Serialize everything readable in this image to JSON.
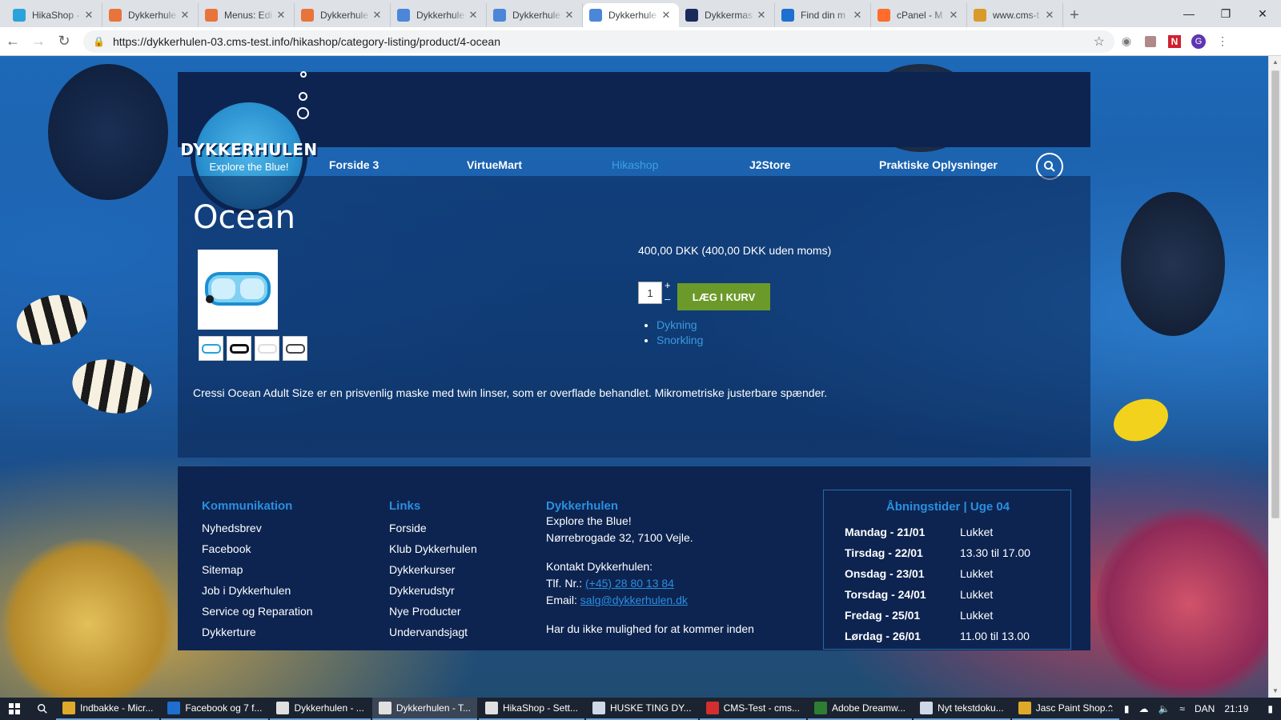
{
  "browser": {
    "tabs": [
      {
        "label": "HikaShop -",
        "color": "#29a3d9"
      },
      {
        "label": "Dykkerhule",
        "color": "#e8743b"
      },
      {
        "label": "Menus: Edi",
        "color": "#e8743b"
      },
      {
        "label": "Dykkerhule",
        "color": "#e8743b"
      },
      {
        "label": "Dykkerhule",
        "color": "#4b86d8"
      },
      {
        "label": "Dykkerhule",
        "color": "#4b86d8"
      },
      {
        "label": "Dykkerhule",
        "color": "#4b86d8"
      },
      {
        "label": "Dykkermas",
        "color": "#1a2a5a"
      },
      {
        "label": "Find din m",
        "color": "#1e6fcf"
      },
      {
        "label": "cPanel - M",
        "color": "#ff6c2c"
      },
      {
        "label": "www.cms-t",
        "color": "#d89b2a"
      }
    ],
    "active_tab_index": 6,
    "new_tab_symbol": "+",
    "url": "https://dykkerhulen-03.cms-test.info/hikashop/category-listing/product/4-ocean",
    "extension_letters": {
      "profile": "G",
      "n_ext": "N"
    }
  },
  "site": {
    "logo": {
      "brand": "DYKKERHULEN",
      "tagline": "Explore the Blue!"
    },
    "nav": [
      "Forside 3",
      "VirtueMart",
      "Hikashop",
      "J2Store",
      "Praktiske Oplysninger"
    ],
    "nav_active": "Hikashop"
  },
  "product": {
    "title": "Ocean",
    "price": "400,00 DKK (400,00 DKK uden moms)",
    "quantity": "1",
    "qty_plus": "+",
    "qty_minus": "–",
    "add_to_cart": "LÆG I KURV",
    "categories": [
      "Dykning",
      "Snorkling"
    ],
    "description": "Cressi Ocean Adult Size er en prisvenlig maske med twin linser, som er overflade behandlet. Mikrometriske justerbare spænder."
  },
  "footer": {
    "kommunikation": {
      "heading": "Kommunikation",
      "links": [
        "Nyhedsbrev",
        "Facebook",
        "Sitemap",
        "Job i Dykkerhulen",
        "Service og Reparation",
        "Dykkerture"
      ]
    },
    "links": {
      "heading": "Links",
      "links": [
        "Forside",
        "Klub Dykkerhulen",
        "Dykkerkurser",
        "Dykkerudstyr",
        "Nye Producter",
        "Undervandsjagt"
      ]
    },
    "contact": {
      "heading": "Dykkerhulen",
      "line1": "Explore the Blue!",
      "line2": "Nørrebrogade 32, 7100 Vejle.",
      "line3": "Kontakt Dykkerhulen:",
      "phone_label": "Tlf. Nr.:",
      "phone": "(+45) 28 80 13 84",
      "email_label": "Email:",
      "email": "salg@dykkerhulen.dk",
      "line_more": "Har du ikke mulighed for at kommer inden"
    },
    "hours": {
      "heading": "Åbningstider | Uge 04",
      "rows": [
        {
          "day": "Mandag - 21/01",
          "time": "Lukket"
        },
        {
          "day": "Tirsdag - 22/01",
          "time": "13.30 til 17.00"
        },
        {
          "day": "Onsdag - 23/01",
          "time": "Lukket"
        },
        {
          "day": "Torsdag - 24/01",
          "time": "Lukket"
        },
        {
          "day": "Fredag - 25/01",
          "time": "Lukket"
        },
        {
          "day": "Lørdag - 26/01",
          "time": "11.00 til 13.00"
        }
      ]
    }
  },
  "taskbar": {
    "items": [
      {
        "label": "Indbakke - Micr...",
        "color": "#e0a92a"
      },
      {
        "label": "Facebook og 7 f...",
        "color": "#1e6fcf"
      },
      {
        "label": "Dykkerhulen - ...",
        "color": "#e0e0e0"
      },
      {
        "label": "Dykkerhulen - T...",
        "color": "#e0e0e0"
      },
      {
        "label": "HikaShop - Sett...",
        "color": "#e0e0e0"
      },
      {
        "label": "HUSKE TING DY...",
        "color": "#cfd8e6"
      },
      {
        "label": "CMS-Test - cms...",
        "color": "#d32f2f"
      },
      {
        "label": "Adobe Dreamw...",
        "color": "#2e7d32"
      },
      {
        "label": "Nyt tekstdoku...",
        "color": "#cfd8e6"
      },
      {
        "label": "Jasc Paint Shop...",
        "color": "#e0a92a"
      }
    ],
    "active_index": 3,
    "language": "DAN",
    "time": "21:19"
  }
}
